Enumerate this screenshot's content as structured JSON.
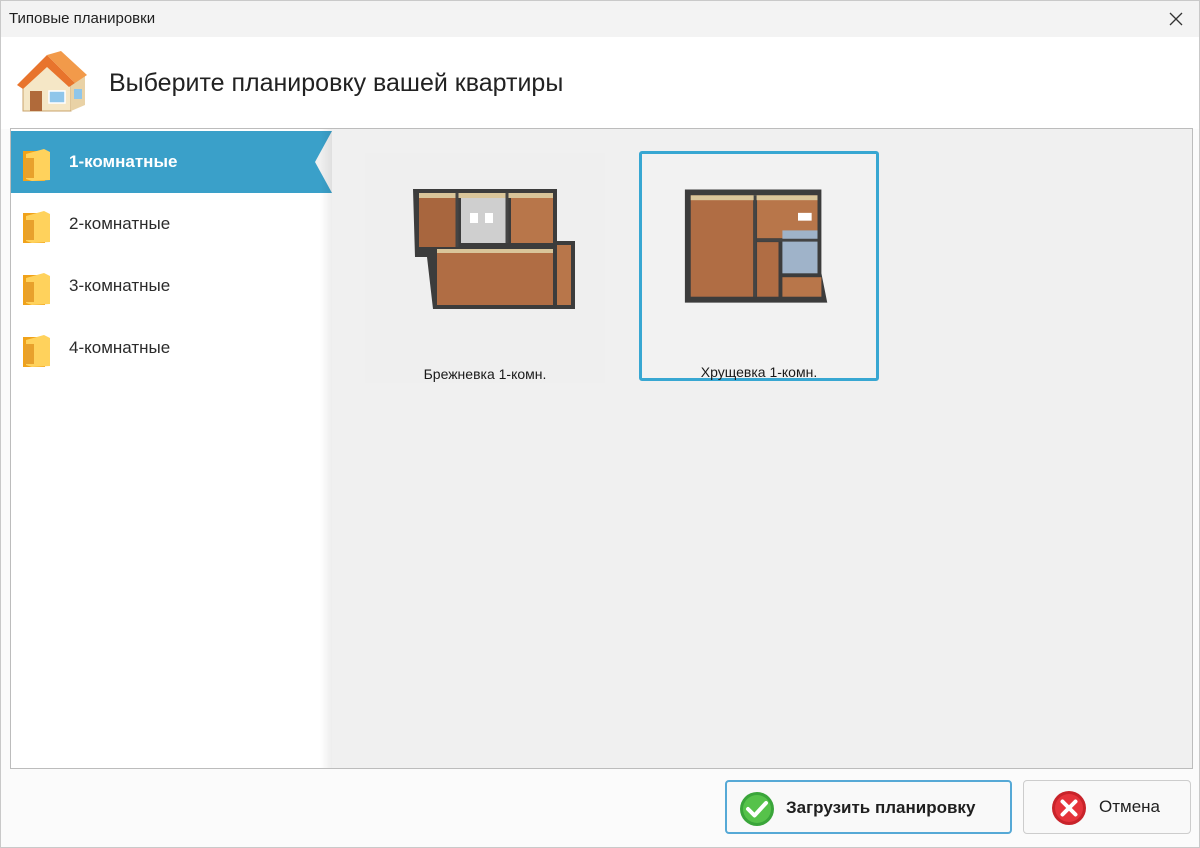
{
  "window": {
    "title": "Типовые планировки"
  },
  "header": {
    "text": "Выберите планировку вашей квартиры",
    "icon": "house-icon"
  },
  "sidebar": {
    "active_index": 0,
    "items": [
      {
        "label": "1-комнатные",
        "icon": "folder-icon"
      },
      {
        "label": "2-комнатные",
        "icon": "folder-icon"
      },
      {
        "label": "3-комнатные",
        "icon": "folder-icon"
      },
      {
        "label": "4-комнатные",
        "icon": "folder-icon"
      }
    ]
  },
  "layouts": {
    "selected_index": 1,
    "items": [
      {
        "caption": "Брежневка 1-комн.",
        "icon": "floor-plan-thumbnail"
      },
      {
        "caption": "Хрущевка 1-комн.",
        "icon": "floor-plan-thumbnail"
      }
    ]
  },
  "buttons": {
    "load": {
      "label": "Загрузить планировку",
      "icon": "green-check-icon"
    },
    "cancel": {
      "label": "Отмена",
      "icon": "red-cancel-icon"
    }
  },
  "colors": {
    "accent": "#3aa0c9",
    "selection_border": "#38a7d2",
    "panel_bg": "#f0f0f0"
  }
}
